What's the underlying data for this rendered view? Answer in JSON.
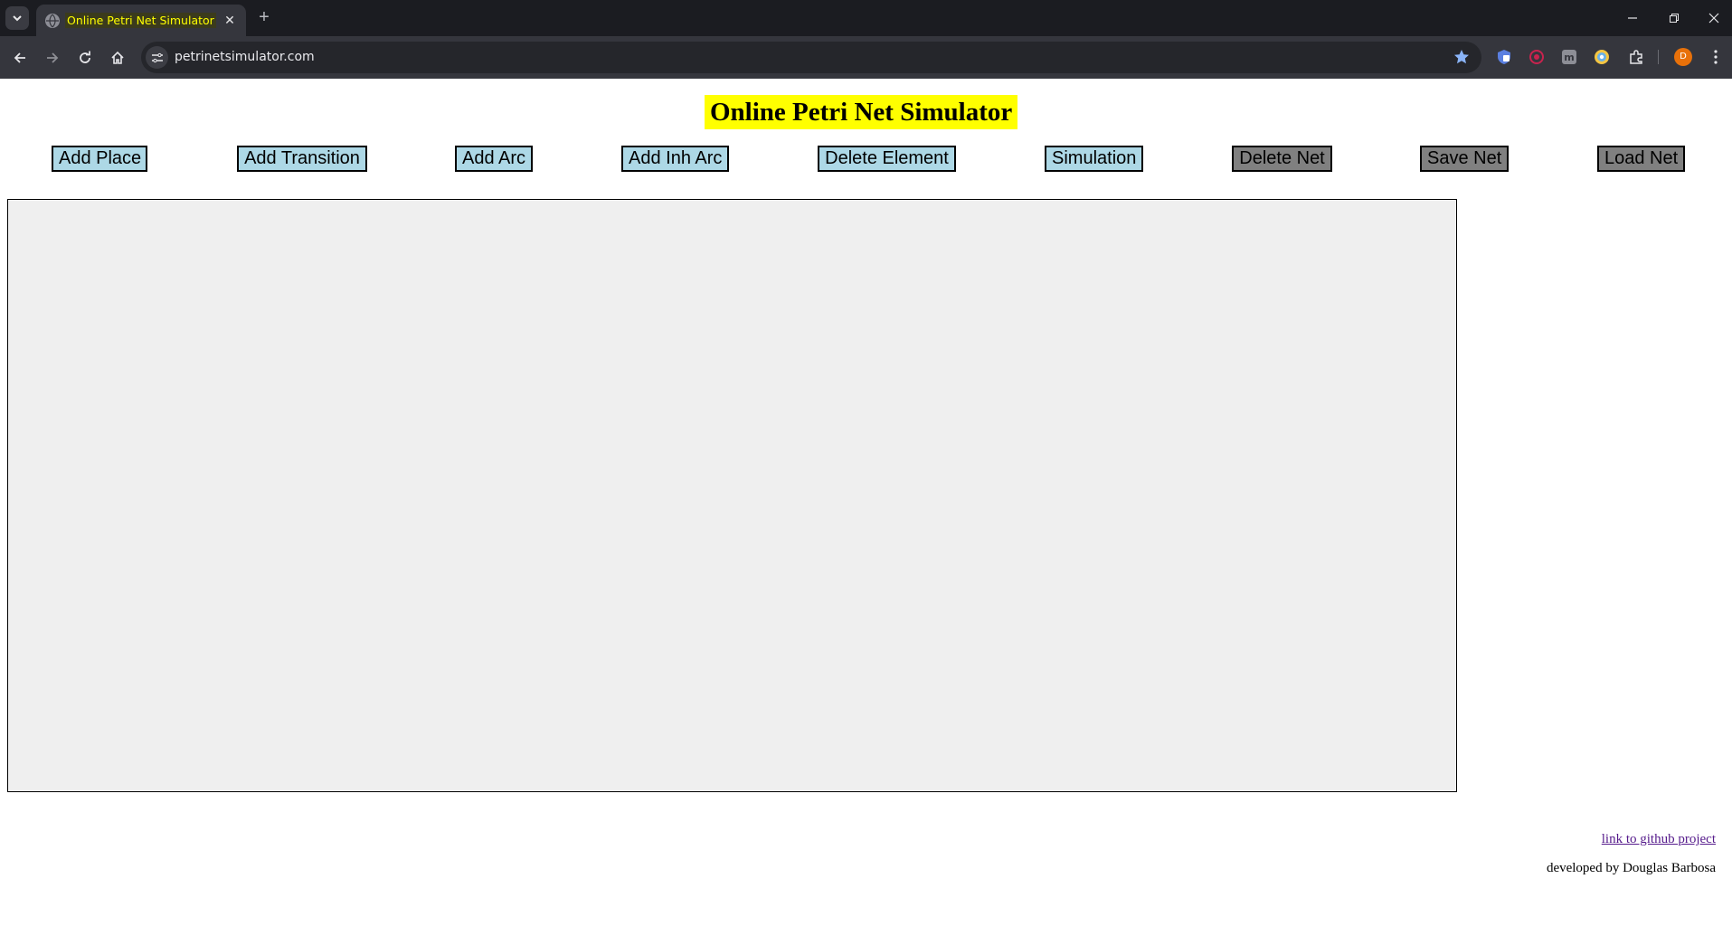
{
  "browser": {
    "tab_title": "Online Petri Net Simulator",
    "url": "petrinetsimulator.com",
    "profile_initial": "D",
    "icons": [
      "chevron-down-icon",
      "globe-icon",
      "close-icon",
      "plus-icon",
      "minimize-icon",
      "restore-icon",
      "back-icon",
      "forward-icon",
      "reload-icon",
      "home-icon",
      "site-settings-icon",
      "star-icon",
      "extensions-icon",
      "menu-icon"
    ]
  },
  "page": {
    "title": "Online Petri Net Simulator",
    "buttons": {
      "add_place": "Add Place",
      "add_transition": "Add Transition",
      "add_arc": "Add Arc",
      "add_inh_arc": "Add Inh Arc",
      "delete_element": "Delete Element",
      "simulation": "Simulation",
      "delete_net": "Delete Net",
      "save_net": "Save Net",
      "load_net": "Load Net"
    },
    "footer": {
      "github_link": "link to github project",
      "credit": "developed by Douglas Barbosa"
    }
  },
  "colors": {
    "title_highlight": "#ffff00",
    "edit_button": "#add8e6",
    "file_button": "#808080",
    "canvas_bg": "#efefef",
    "link": "#551a8b"
  }
}
